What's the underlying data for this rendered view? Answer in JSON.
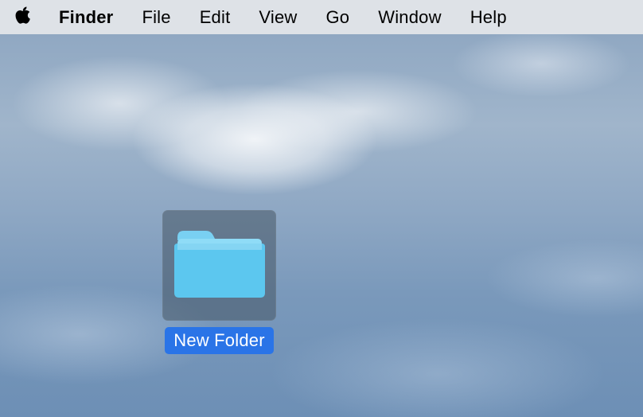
{
  "menubar": {
    "app_name": "Finder",
    "items": [
      "File",
      "Edit",
      "View",
      "Go",
      "Window",
      "Help"
    ]
  },
  "desktop": {
    "selected_folder": {
      "name": "New Folder"
    }
  }
}
